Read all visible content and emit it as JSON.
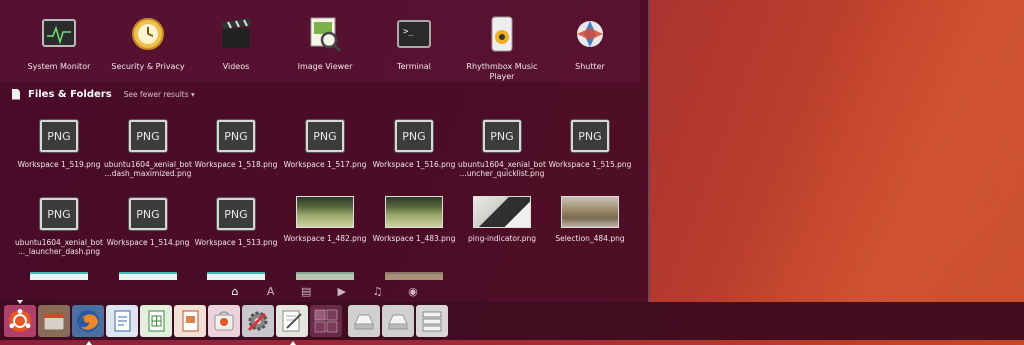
{
  "apps": [
    {
      "label": "System Monitor",
      "icon": "system-monitor-icon"
    },
    {
      "label": "Security & Privacy",
      "icon": "security-privacy-icon"
    },
    {
      "label": "Videos",
      "icon": "videos-clapper-icon"
    },
    {
      "label": "Image Viewer",
      "icon": "image-viewer-icon"
    },
    {
      "label": "Terminal",
      "icon": "terminal-icon"
    },
    {
      "label": "Rhythmbox Music Player",
      "icon": "rhythmbox-icon"
    },
    {
      "label": "Shutter",
      "icon": "shutter-icon"
    }
  ],
  "files_section": {
    "title": "Files & Folders",
    "toggle": "See fewer results"
  },
  "png_label": "PNG",
  "files_row1": [
    {
      "name": "Workspace 1_519.png",
      "kind": "png"
    },
    {
      "name": "ubuntu1604_xenial_bot ...dash_maximized.png",
      "kind": "png"
    },
    {
      "name": "Workspace 1_518.png",
      "kind": "png"
    },
    {
      "name": "Workspace 1_517.png",
      "kind": "png"
    },
    {
      "name": "Workspace 1_516.png",
      "kind": "png"
    },
    {
      "name": "ubuntu1604_xenial_bot ...uncher_quicklist.png",
      "kind": "png"
    },
    {
      "name": "Workspace 1_515.png",
      "kind": "png"
    }
  ],
  "files_row2": [
    {
      "name": "ubuntu1604_xenial_bot ..._launcher_dash.png",
      "kind": "png"
    },
    {
      "name": "Workspace 1_514.png",
      "kind": "png"
    },
    {
      "name": "Workspace 1_513.png",
      "kind": "png"
    },
    {
      "name": "Workspace 1_482.png",
      "kind": "thumb-a"
    },
    {
      "name": "Workspace 1_483.png",
      "kind": "thumb-a"
    },
    {
      "name": "ping-indicator.png",
      "kind": "thumb-b"
    },
    {
      "name": "Selection_484.png",
      "kind": "thumb-c"
    }
  ],
  "lenses": [
    {
      "icon": "home-lens-icon",
      "glyph": "⌂",
      "active": true
    },
    {
      "icon": "applications-lens-icon",
      "glyph": "A",
      "active": false
    },
    {
      "icon": "files-lens-icon",
      "glyph": "▤",
      "active": false
    },
    {
      "icon": "video-lens-icon",
      "glyph": "▶",
      "active": false
    },
    {
      "icon": "music-lens-icon",
      "glyph": "♫",
      "active": false
    },
    {
      "icon": "photo-lens-icon",
      "glyph": "◉",
      "active": false
    }
  ],
  "launcher_icons": [
    "ubuntu-dash-icon",
    "files-manager-icon",
    "firefox-icon",
    "libreoffice-writer-icon",
    "libreoffice-calc-icon",
    "libreoffice-impress-icon",
    "software-center-icon",
    "system-settings-icon",
    "text-editor-icon",
    "workspace-switcher-icon",
    "drive-icon",
    "drive-icon",
    "file-storage-icon"
  ]
}
